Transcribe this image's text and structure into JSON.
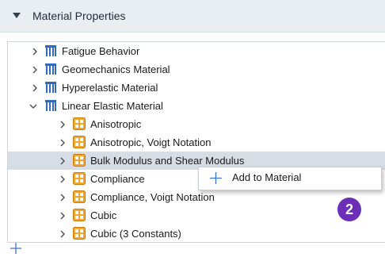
{
  "header": {
    "title": "Material Properties"
  },
  "tree": {
    "groups": [
      {
        "label": "Fatigue Behavior"
      },
      {
        "label": "Geomechanics Material"
      },
      {
        "label": "Hyperelastic Material"
      },
      {
        "label": "Linear Elastic Material"
      }
    ],
    "children": [
      {
        "label": "Anisotropic"
      },
      {
        "label": "Anisotropic, Voigt Notation"
      },
      {
        "label": "Bulk Modulus and Shear Modulus"
      },
      {
        "label": "Compliance"
      },
      {
        "label": "Compliance, Voigt Notation"
      },
      {
        "label": "Cubic"
      },
      {
        "label": "Cubic (3 Constants)"
      }
    ]
  },
  "context_menu": {
    "add_to_material": "Add to Material"
  },
  "badge": {
    "number": "2"
  },
  "colors": {
    "accent_blue": "#3b74c9",
    "badge_purple": "#6b2fb8",
    "highlight": "#d7dde4"
  }
}
